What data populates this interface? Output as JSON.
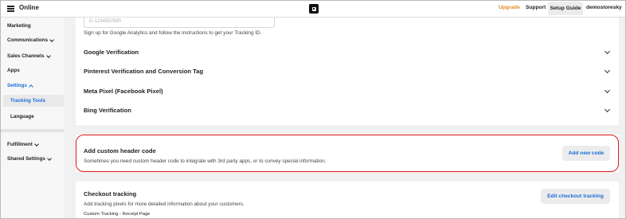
{
  "topbar": {
    "app_title": "Online",
    "upgrade": "Upgrade",
    "support": "Support",
    "setup_guide": "Setup Guide",
    "account": "demostoresky"
  },
  "sidebar": {
    "items": [
      {
        "label": "Marketing"
      },
      {
        "label": "Communications"
      },
      {
        "label": "Sales Channels"
      },
      {
        "label": "Apps"
      },
      {
        "label": "Settings"
      },
      {
        "label": "Tracking Tools"
      },
      {
        "label": "Language"
      },
      {
        "label": "Fulfillment"
      },
      {
        "label": "Shared Settings"
      }
    ]
  },
  "main": {
    "ga_input_value": "G-1234567890",
    "ga_help": "Sign up for Google Analytics and follow the instructions to get your Tracking ID.",
    "accordions": [
      {
        "label": "Google Verification"
      },
      {
        "label": "Pinterest Verification and Conversion Tag"
      },
      {
        "label": "Meta Pixel (Facebook Pixel)"
      },
      {
        "label": "Bing Verification"
      }
    ],
    "custom_header": {
      "title": "Add custom header code",
      "description": "Sometimes you need custom header code to integrate with 3rd party apps, or to convey special information.",
      "button": "Add new code"
    },
    "checkout": {
      "title": "Checkout tracking",
      "description": "Add tracking pixels for more detailed information about your customers.",
      "button": "Edit checkout tracking",
      "subheading": "Custom Tracking - Receipt Page"
    }
  },
  "colors": {
    "accent": "#1a6ed8",
    "upgrade": "#e08a1e",
    "highlight": "#e11b1b"
  }
}
